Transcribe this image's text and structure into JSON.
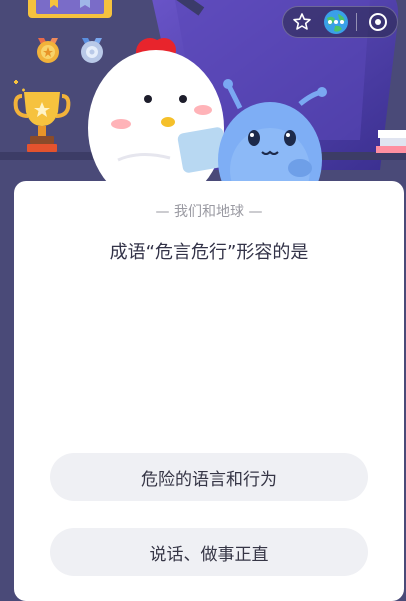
{
  "header": {
    "icons": [
      "medal-icon",
      "medal-icon",
      "star-medal-icon",
      "gear-medal-icon",
      "trophy-icon",
      "star-outline-icon",
      "earth-icon",
      "more-icon",
      "close-icon"
    ]
  },
  "quiz": {
    "subtitle": "— 我们和地球 —",
    "question": "成语“危言危行”形容的是",
    "options": [
      {
        "label": "危险的语言和行为"
      },
      {
        "label": "说话、做事正直"
      }
    ]
  },
  "colors": {
    "scene_bg": "#4a4a78",
    "card_bg": "#ffffff",
    "option_bg": "#eff0f4",
    "subtitle": "#9a9aa2",
    "text": "#333348"
  }
}
